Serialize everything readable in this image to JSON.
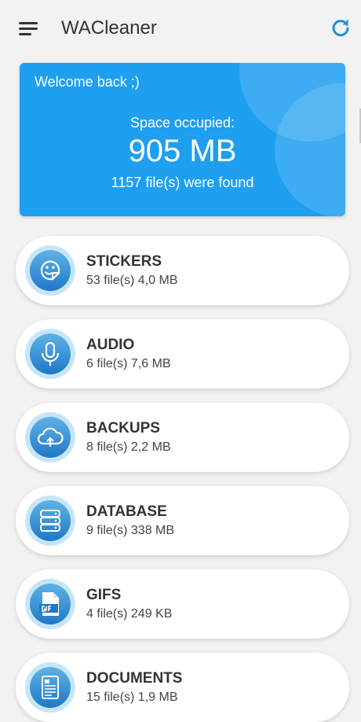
{
  "app": {
    "title": "WACleaner",
    "menu_icon": "hamburger-menu-icon",
    "refresh_icon": "refresh-icon",
    "accent_color": "#1e9ff0"
  },
  "summary": {
    "welcome": "Welcome back ;)",
    "space_label": "Space occupied:",
    "space_value": "905 MB",
    "files_found": "1157 file(s) were found"
  },
  "categories": [
    {
      "title": "STICKERS",
      "subtitle": "53 file(s) 4,0 MB",
      "icon": "sticker-icon"
    },
    {
      "title": "AUDIO",
      "subtitle": "6 file(s) 7,6 MB",
      "icon": "microphone-icon"
    },
    {
      "title": "BACKUPS",
      "subtitle": "8 file(s) 2,2 MB",
      "icon": "cloud-upload-icon"
    },
    {
      "title": "DATABASE",
      "subtitle": "9 file(s) 338 MB",
      "icon": "database-icon"
    },
    {
      "title": "GIFS",
      "subtitle": "4 file(s) 249 KB",
      "icon": "gif-file-icon"
    },
    {
      "title": "DOCUMENTS",
      "subtitle": "15 file(s) 1,9 MB",
      "icon": "document-icon"
    }
  ]
}
